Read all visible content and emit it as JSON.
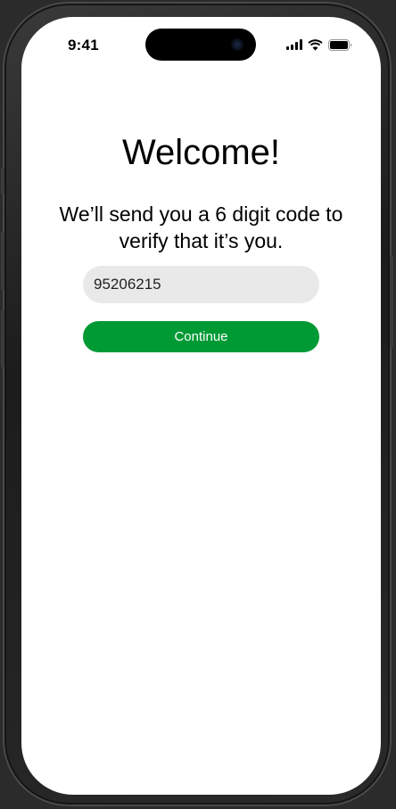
{
  "status_bar": {
    "time": "9:41"
  },
  "welcome": {
    "title": "Welcome!",
    "subtitle": "We’ll send you a 6 digit code to verify that it’s you.",
    "code_input_value": "95206215",
    "continue_label": "Continue"
  },
  "colors": {
    "accent": "#009a35",
    "input_background": "#e9e9e9",
    "screen_background": "#ffffff"
  },
  "icons": [
    "signal-icon",
    "wifi-icon",
    "battery-icon",
    "front-camera-icon"
  ]
}
